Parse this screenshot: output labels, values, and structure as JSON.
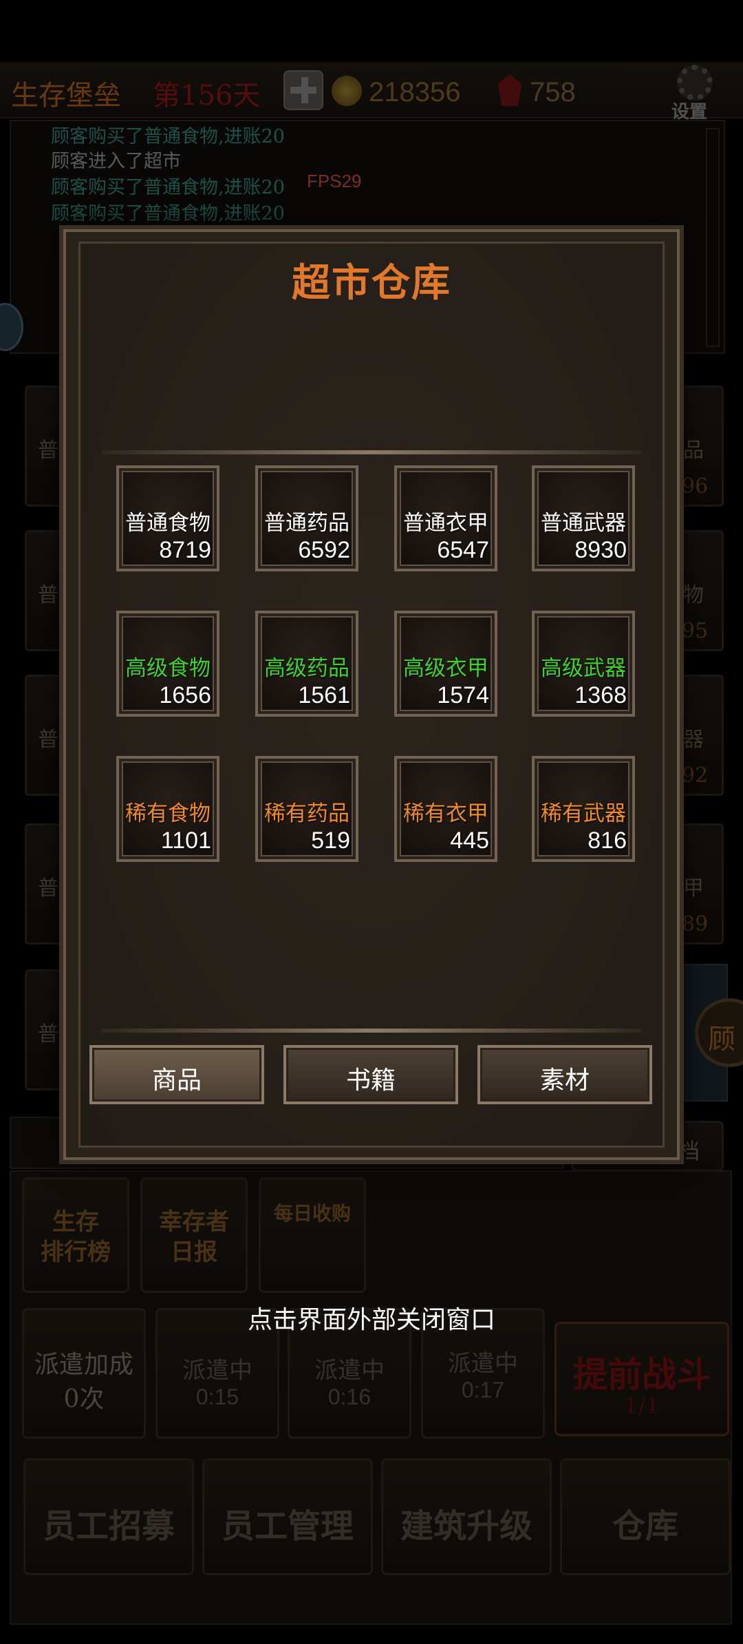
{
  "topbar": {
    "title": "生存堡垒",
    "day": "第156天",
    "coins": "218356",
    "gems": "758",
    "settings": "设置"
  },
  "log": {
    "lines": [
      "顾客购买了普通食物,进账20",
      "顾客进入了超市",
      "顾客购买了普通食物,进账20",
      "顾客购买了普通食物,进账20"
    ],
    "fps": "FPS29"
  },
  "side": {
    "left_labels": [
      "普",
      "普",
      "普",
      "普",
      "普"
    ],
    "right_labels": [
      "品",
      "物",
      "器",
      "甲"
    ],
    "right_numbers": [
      "96",
      "95",
      "92",
      "89"
    ],
    "right_button": "顾",
    "right_small": "档"
  },
  "bottom": {
    "rank": [
      "生存",
      "排行榜"
    ],
    "report": [
      "幸存者",
      "日报"
    ],
    "daily": "每日收购",
    "close_hint": "点击界面外部关闭窗口",
    "dispatch_bonus_label": "派遣加成",
    "dispatch_bonus_value": "0次",
    "dispatching": [
      {
        "label": "派遣中",
        "time": "0:15"
      },
      {
        "label": "派遣中",
        "time": "0:16"
      },
      {
        "label": "派遣中",
        "time": "0:17"
      }
    ],
    "early_battle": "提前战斗",
    "early_battle_sub": "1/1",
    "actions": [
      "员工招募",
      "员工管理",
      "建筑升级",
      "仓库"
    ]
  },
  "modal": {
    "title": "超市仓库",
    "items": [
      {
        "name": "普通食物",
        "count": "8719",
        "color": "#ffffff"
      },
      {
        "name": "普通药品",
        "count": "6592",
        "color": "#ffffff"
      },
      {
        "name": "普通衣甲",
        "count": "6547",
        "color": "#ffffff"
      },
      {
        "name": "普通武器",
        "count": "8930",
        "color": "#ffffff"
      },
      {
        "name": "高级食物",
        "count": "1656",
        "color": "#3fd12f"
      },
      {
        "name": "高级药品",
        "count": "1561",
        "color": "#3fd12f"
      },
      {
        "name": "高级衣甲",
        "count": "1574",
        "color": "#3fd12f"
      },
      {
        "name": "高级武器",
        "count": "1368",
        "color": "#3fd12f"
      },
      {
        "name": "稀有食物",
        "count": "1101",
        "color": "#ee8a2a"
      },
      {
        "name": "稀有药品",
        "count": "519",
        "color": "#ee8a2a"
      },
      {
        "name": "稀有衣甲",
        "count": "445",
        "color": "#ee8a2a"
      },
      {
        "name": "稀有武器",
        "count": "816",
        "color": "#ee8a2a"
      }
    ],
    "tabs": [
      "商品",
      "书籍",
      "素材"
    ],
    "active_tab": "商品"
  }
}
